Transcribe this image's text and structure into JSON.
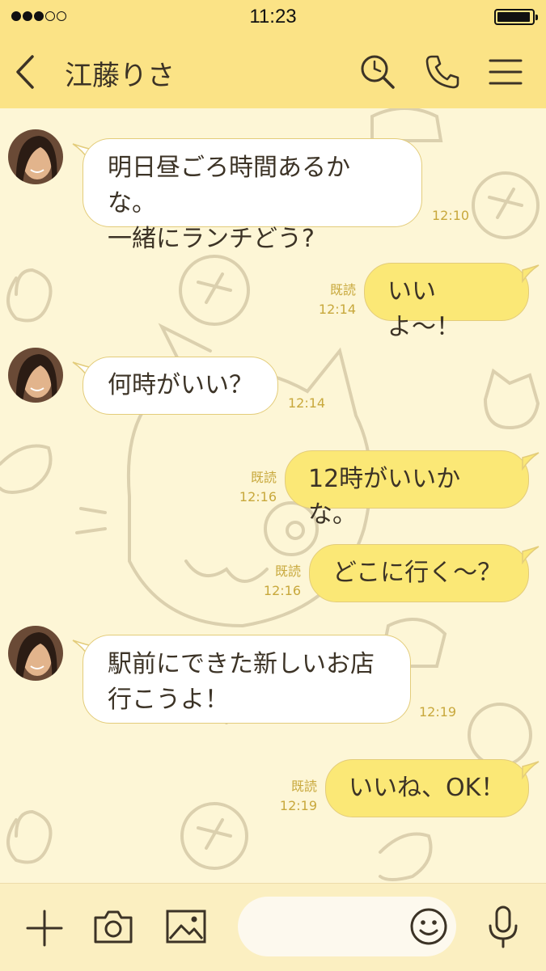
{
  "status_bar": {
    "time": "11:23",
    "signal_bars": 3,
    "signal_total": 5,
    "battery_level": 0.95
  },
  "header": {
    "contact_name": "江藤りさ",
    "icons": [
      "back-icon",
      "search-icon",
      "phone-icon",
      "menu-icon"
    ]
  },
  "messages": [
    {
      "direction": "in",
      "text": "明日昼ごろ時間あるかな。\n一緒にランチどう?",
      "time": "12:10"
    },
    {
      "direction": "out",
      "text": "いいよ〜！",
      "read": "既読",
      "time": "12:14"
    },
    {
      "direction": "in",
      "text": "何時がいい？",
      "time": "12:14"
    },
    {
      "direction": "out",
      "text": "12時がいいかな。",
      "read": "既読",
      "time": "12:16"
    },
    {
      "direction": "out",
      "text": "どこに行く〜？",
      "read": "既読",
      "time": "12:16"
    },
    {
      "direction": "in",
      "text": "駅前にできた新しいお店\n行こうよ！",
      "time": "12:19"
    },
    {
      "direction": "out",
      "text": "いいね、OK！",
      "read": "既読",
      "time": "12:19"
    }
  ],
  "input_bar": {
    "icons": [
      "plus-icon",
      "camera-icon",
      "image-icon",
      "emoji-icon",
      "microphone-icon"
    ],
    "placeholder": ""
  },
  "colors": {
    "header_bg": "#fbe386",
    "chat_bg": "#fdf6d6",
    "incoming_bubble": "#ffffff",
    "outgoing_bubble": "#fbe876",
    "meta_text": "#c8a83c",
    "text": "#3c3326"
  }
}
